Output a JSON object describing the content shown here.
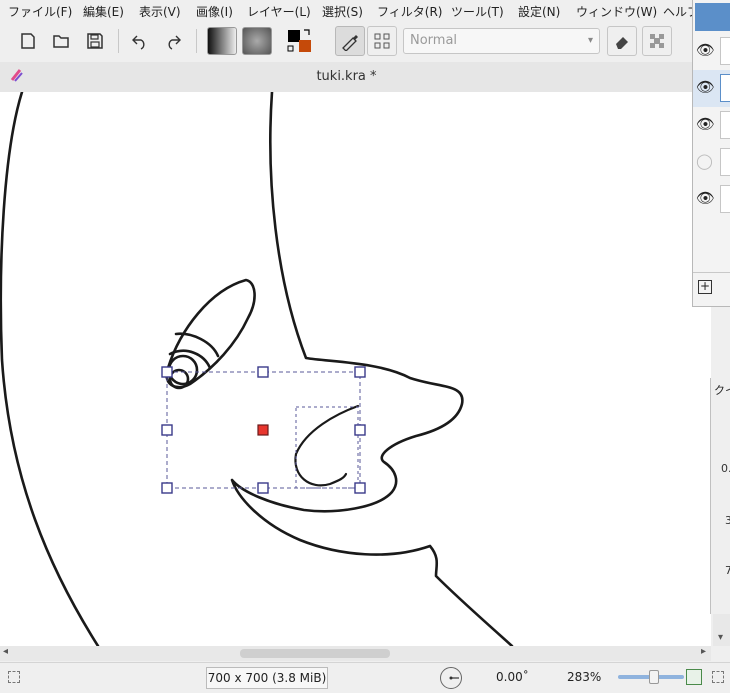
{
  "menu": [
    "ファイル(F)",
    "編集(E)",
    "表示(V)",
    "画像(I)",
    "レイヤー(L)",
    "選択(S)",
    "フィルタ(R)",
    "ツール(T)",
    "設定(N)",
    "ウィンドウ(W)",
    "ヘルプ"
  ],
  "toolbar": {
    "blend_mode": "Normal",
    "icons": [
      "new-document-icon",
      "open-folder-icon",
      "save-icon",
      "undo-icon",
      "redo-icon",
      "gradient-icon",
      "pattern-icon",
      "color-swap-icon",
      "brush-preset-icon",
      "brush-settings-icon",
      "eraser-icon",
      "alpha-lock-icon"
    ]
  },
  "document": {
    "title": "tuki.kra *"
  },
  "status": {
    "image_size": "700 x 700 (3.8 MiB)",
    "rotation": "0.00˚",
    "zoom": "283%",
    "zoom_slider_level": 0.55
  },
  "layers_panel": {
    "header_color": "#5b8fc9",
    "add_label": "+"
  },
  "quick_panel": {
    "title": "クイ",
    "labels": [
      "0.",
      "3",
      "7"
    ]
  },
  "colors": {
    "foreground": "#000000",
    "background": "#c54a0a",
    "handle_active": "#e8362e",
    "handle": "#4a4a9a"
  }
}
